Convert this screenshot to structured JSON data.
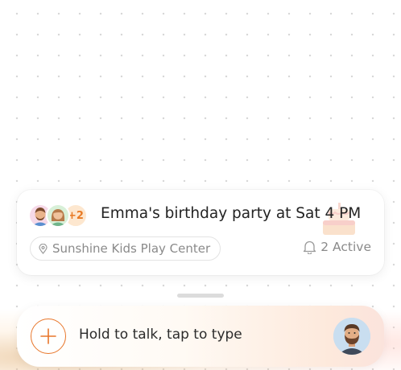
{
  "event": {
    "participant_avatars": [
      "man-avatar",
      "woman-avatar"
    ],
    "extra_count": "+2",
    "title": "Emma's birthday party at Sat 4 PM",
    "location": "Sunshine Kids Play Center",
    "active_status": "2 Active",
    "decoration_icon": "cake-icon"
  },
  "composer": {
    "add_icon": "plus-icon",
    "placeholder": "Hold to talk, tap to type",
    "user_avatar": "bearded-man-avatar"
  },
  "colors": {
    "accent": "#e8762a",
    "muted_text": "#8a8a8a",
    "count_badge_bg": "#fde7cf"
  }
}
